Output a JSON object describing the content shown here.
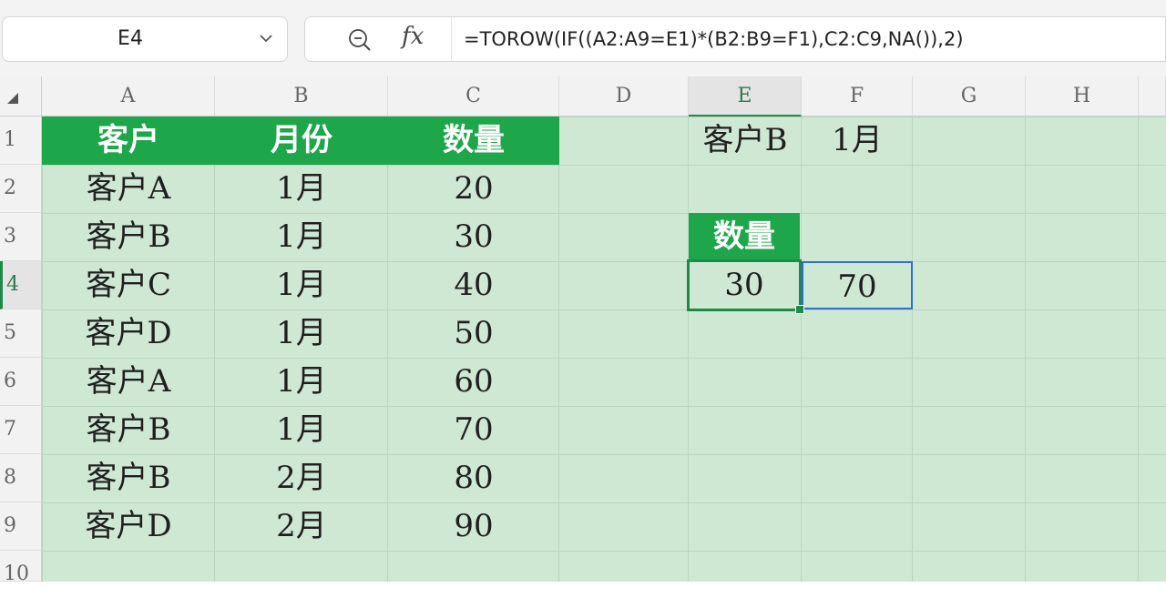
{
  "formula_bar": {
    "name_box": "E4",
    "fx_label": "fx",
    "formula": "=TOROW(IF((A2:A9=E1)*(B2:B9=F1),C2:C9,NA()),2)"
  },
  "columns": [
    "A",
    "B",
    "C",
    "D",
    "E",
    "F",
    "G",
    "H"
  ],
  "rows": [
    "1",
    "2",
    "3",
    "4",
    "5",
    "6",
    "7",
    "8",
    "9",
    "10"
  ],
  "table": {
    "headers": [
      "客户",
      "月份",
      "数量"
    ],
    "rows": [
      [
        "客户A",
        "1月",
        "20"
      ],
      [
        "客户B",
        "1月",
        "30"
      ],
      [
        "客户C",
        "1月",
        "40"
      ],
      [
        "客户D",
        "1月",
        "50"
      ],
      [
        "客户A",
        "1月",
        "60"
      ],
      [
        "客户B",
        "1月",
        "70"
      ],
      [
        "客户B",
        "2月",
        "80"
      ],
      [
        "客户D",
        "2月",
        "90"
      ]
    ]
  },
  "criteria": {
    "e1": "客户B",
    "f1": "1月"
  },
  "result": {
    "header": "数量",
    "values": [
      "30",
      "70"
    ]
  },
  "colors": {
    "header_green": "#1ea64a",
    "cell_bg": "#cfe8d4",
    "active_border": "#1e8a4a",
    "spill_border": "#2f6fd1"
  }
}
